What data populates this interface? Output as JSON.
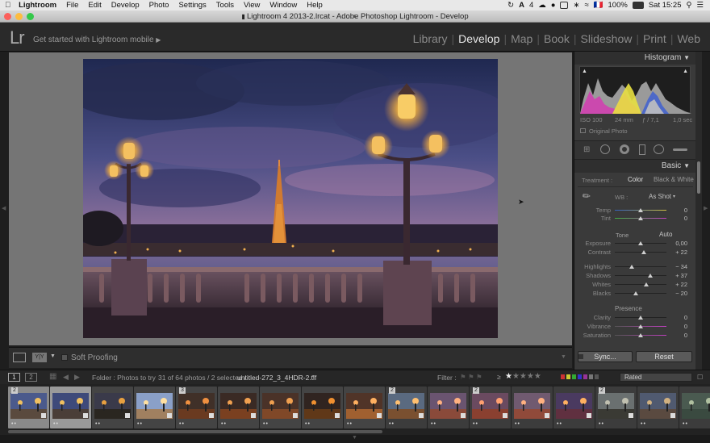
{
  "menubar": {
    "app": "Lightroom",
    "items": [
      "File",
      "Edit",
      "Develop",
      "Photo",
      "Settings",
      "Tools",
      "View",
      "Window",
      "Help"
    ],
    "status": {
      "battery": "100%",
      "clock": "Sat 15:25",
      "flag": "🇫🇷",
      "num": "4"
    }
  },
  "window": {
    "title": "Lightroom 4 2013-2.lrcat - Adobe Photoshop Lightroom - Develop"
  },
  "header": {
    "logo": "Lr",
    "mobile": "Get started with Lightroom mobile",
    "modules": [
      "Library",
      "Develop",
      "Map",
      "Book",
      "Slideshow",
      "Print",
      "Web"
    ],
    "active_module": "Develop"
  },
  "toolbar": {
    "soft_proofing": "Soft Proofing"
  },
  "histogram": {
    "title": "Histogram",
    "iso": "ISO 100",
    "focal": "24 mm",
    "aperture": "ƒ / 7,1",
    "shutter": "1,0 sec",
    "original": "Original Photo"
  },
  "basic": {
    "title": "Basic",
    "treatment_label": "Treatment :",
    "color": "Color",
    "bw": "Black & White",
    "wb_label": "WB :",
    "wb_value": "As Shot",
    "tone": "Tone",
    "auto": "Auto",
    "presence": "Presence",
    "sliders": [
      {
        "label": "Temp",
        "value": "0",
        "pos": 0.5
      },
      {
        "label": "Tint",
        "value": "0",
        "pos": 0.5
      },
      {
        "label": "Exposure",
        "value": "0,00",
        "pos": 0.5
      },
      {
        "label": "Contrast",
        "value": "+ 22",
        "pos": 0.56
      },
      {
        "label": "Highlights",
        "value": "− 34",
        "pos": 0.33
      },
      {
        "label": "Shadows",
        "value": "+ 37",
        "pos": 0.69
      },
      {
        "label": "Whites",
        "value": "+ 22",
        "pos": 0.61
      },
      {
        "label": "Blacks",
        "value": "− 20",
        "pos": 0.4
      },
      {
        "label": "Clarity",
        "value": "0",
        "pos": 0.5
      },
      {
        "label": "Vibrance",
        "value": "0",
        "pos": 0.5
      },
      {
        "label": "Saturation",
        "value": "0",
        "pos": 0.5
      }
    ]
  },
  "actions": {
    "sync": "Sync...",
    "reset": "Reset"
  },
  "filmstrip_header": {
    "view1": "1",
    "view2": "2",
    "folder": "Folder : Photos to try",
    "count": "31 of 64 photos / 2 selected /",
    "file": "untitled-272_3_4HDR-2.tif",
    "filter": "Filter :",
    "ge": "≥",
    "rated": "Rated"
  },
  "filmstrip": {
    "thumbs": [
      {
        "badge": "2",
        "sky": "#4b5a8c",
        "ground": "#5a4a3e",
        "light": "#f0c060",
        "bg": "#8a8a8a"
      },
      {
        "badge": "",
        "sky": "#3e4a7a",
        "ground": "#4a3e38",
        "light": "#f0c060",
        "bg": "#9a9a9a"
      },
      {
        "badge": "",
        "sky": "#3a3a4a",
        "ground": "#2a2620",
        "light": "#e8a040",
        "bg": "#444444"
      },
      {
        "badge": "",
        "sky": "#8aa0c8",
        "ground": "#a08060",
        "light": "#ffe0a0",
        "bg": "#444444"
      },
      {
        "badge": "3",
        "sky": "#403028",
        "ground": "#6a3a20",
        "light": "#f09040",
        "bg": "#444444"
      },
      {
        "badge": "",
        "sky": "#3a2a24",
        "ground": "#7a4020",
        "light": "#f0a050",
        "bg": "#444444"
      },
      {
        "badge": "",
        "sky": "#4a3228",
        "ground": "#804828",
        "light": "#f0a050",
        "bg": "#444444"
      },
      {
        "badge": "",
        "sky": "#302420",
        "ground": "#603818",
        "light": "#f09030",
        "bg": "#444444"
      },
      {
        "badge": "",
        "sky": "#503428",
        "ground": "#a06030",
        "light": "#ffb060",
        "bg": "#444444"
      },
      {
        "badge": "2",
        "sky": "#5a6a80",
        "ground": "#7a5030",
        "light": "#ffc070",
        "bg": "#3c3c3c"
      },
      {
        "badge": "",
        "sky": "#6a5470",
        "ground": "#8a4a3a",
        "light": "#ffb080",
        "bg": "#3c3c3c"
      },
      {
        "badge": "2",
        "sky": "#6a4a60",
        "ground": "#8a4030",
        "light": "#ffa070",
        "bg": "#3c3c3c"
      },
      {
        "badge": "",
        "sky": "#705a70",
        "ground": "#904a3a",
        "light": "#ffb080",
        "bg": "#3c3c3c"
      },
      {
        "badge": "",
        "sky": "#4a3a60",
        "ground": "#603040",
        "light": "#ffb060",
        "bg": "#3c3c3c"
      },
      {
        "badge": "2",
        "sky": "#6a7070",
        "ground": "#3a3a34",
        "light": "#c0c0b0",
        "bg": "#3c3c3c"
      },
      {
        "badge": "",
        "sky": "#505a70",
        "ground": "#5a4a40",
        "light": "#d0b080",
        "bg": "#3c3c3c"
      },
      {
        "badge": "",
        "sky": "#4a5a50",
        "ground": "#3a4a40",
        "light": "#b0c0a0",
        "bg": "#3c3c3c"
      }
    ]
  }
}
